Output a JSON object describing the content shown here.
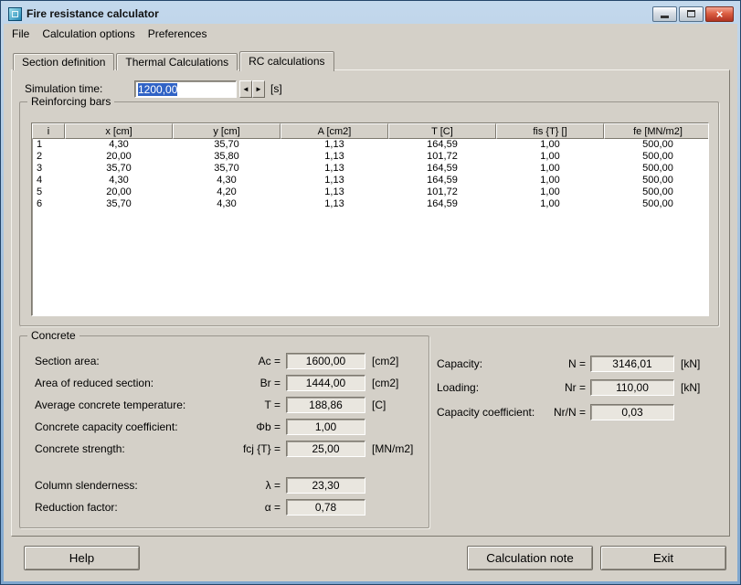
{
  "window": {
    "title": "Fire resistance calculator",
    "menu": [
      "File",
      "Calculation options",
      "Preferences"
    ]
  },
  "tabs": [
    {
      "label": "Section definition"
    },
    {
      "label": "Thermal Calculations"
    },
    {
      "label": "RC calculations"
    }
  ],
  "simulation_time": {
    "label": "Simulation time:",
    "value": "1200,00",
    "unit": "[s]"
  },
  "reinforcing_bars": {
    "title": "Reinforcing bars",
    "columns": [
      "i",
      "x [cm]",
      "y [cm]",
      "A [cm2]",
      "T [C]",
      "fis {T} []",
      "fe [MN/m2]"
    ],
    "rows": [
      [
        "1",
        "4,30",
        "35,70",
        "1,13",
        "164,59",
        "1,00",
        "500,00"
      ],
      [
        "2",
        "20,00",
        "35,80",
        "1,13",
        "101,72",
        "1,00",
        "500,00"
      ],
      [
        "3",
        "35,70",
        "35,70",
        "1,13",
        "164,59",
        "1,00",
        "500,00"
      ],
      [
        "4",
        "4,30",
        "4,30",
        "1,13",
        "164,59",
        "1,00",
        "500,00"
      ],
      [
        "5",
        "20,00",
        "4,20",
        "1,13",
        "101,72",
        "1,00",
        "500,00"
      ],
      [
        "6",
        "35,70",
        "4,30",
        "1,13",
        "164,59",
        "1,00",
        "500,00"
      ]
    ]
  },
  "concrete": {
    "title": "Concrete",
    "fields": [
      {
        "label": "Section area:",
        "symbol": "Ac =",
        "value": "1600,00",
        "unit": "[cm2]"
      },
      {
        "label": "Area of reduced section:",
        "symbol": "Br =",
        "value": "1444,00",
        "unit": "[cm2]"
      },
      {
        "label": "Average concrete temperature:",
        "symbol": "T =",
        "value": "188,86",
        "unit": "[C]"
      },
      {
        "label": "Concrete capacity coefficient:",
        "symbol": "Φb =",
        "value": "1,00",
        "unit": ""
      },
      {
        "label": "Concrete strength:",
        "symbol": "fcj {T} =",
        "value": "25,00",
        "unit": "[MN/m2]"
      },
      {
        "label": "Column slenderness:",
        "symbol": "λ =",
        "value": "23,30",
        "unit": ""
      },
      {
        "label": "Reduction factor:",
        "symbol": "α =",
        "value": "0,78",
        "unit": ""
      }
    ]
  },
  "capacity": {
    "fields": [
      {
        "label": "Capacity:",
        "symbol": "N =",
        "value": "3146,01",
        "unit": "[kN]"
      },
      {
        "label": "Loading:",
        "symbol": "Nr =",
        "value": "110,00",
        "unit": "[kN]"
      },
      {
        "label": "Capacity coefficient:",
        "symbol": "Nr/N =",
        "value": "0,03",
        "unit": ""
      }
    ]
  },
  "buttons": {
    "help": "Help",
    "calculation_note": "Calculation note",
    "exit": "Exit"
  },
  "icons": {
    "spin_left": "◄",
    "spin_right": "►",
    "close": "×"
  },
  "colors": {
    "selection_blue": "#3163c5",
    "dialog_gray": "#d4d0c8",
    "titlebar_top": "#c3d8ec",
    "titlebar_bottom": "#7fa7cf",
    "close_button_red": "#b03321"
  }
}
